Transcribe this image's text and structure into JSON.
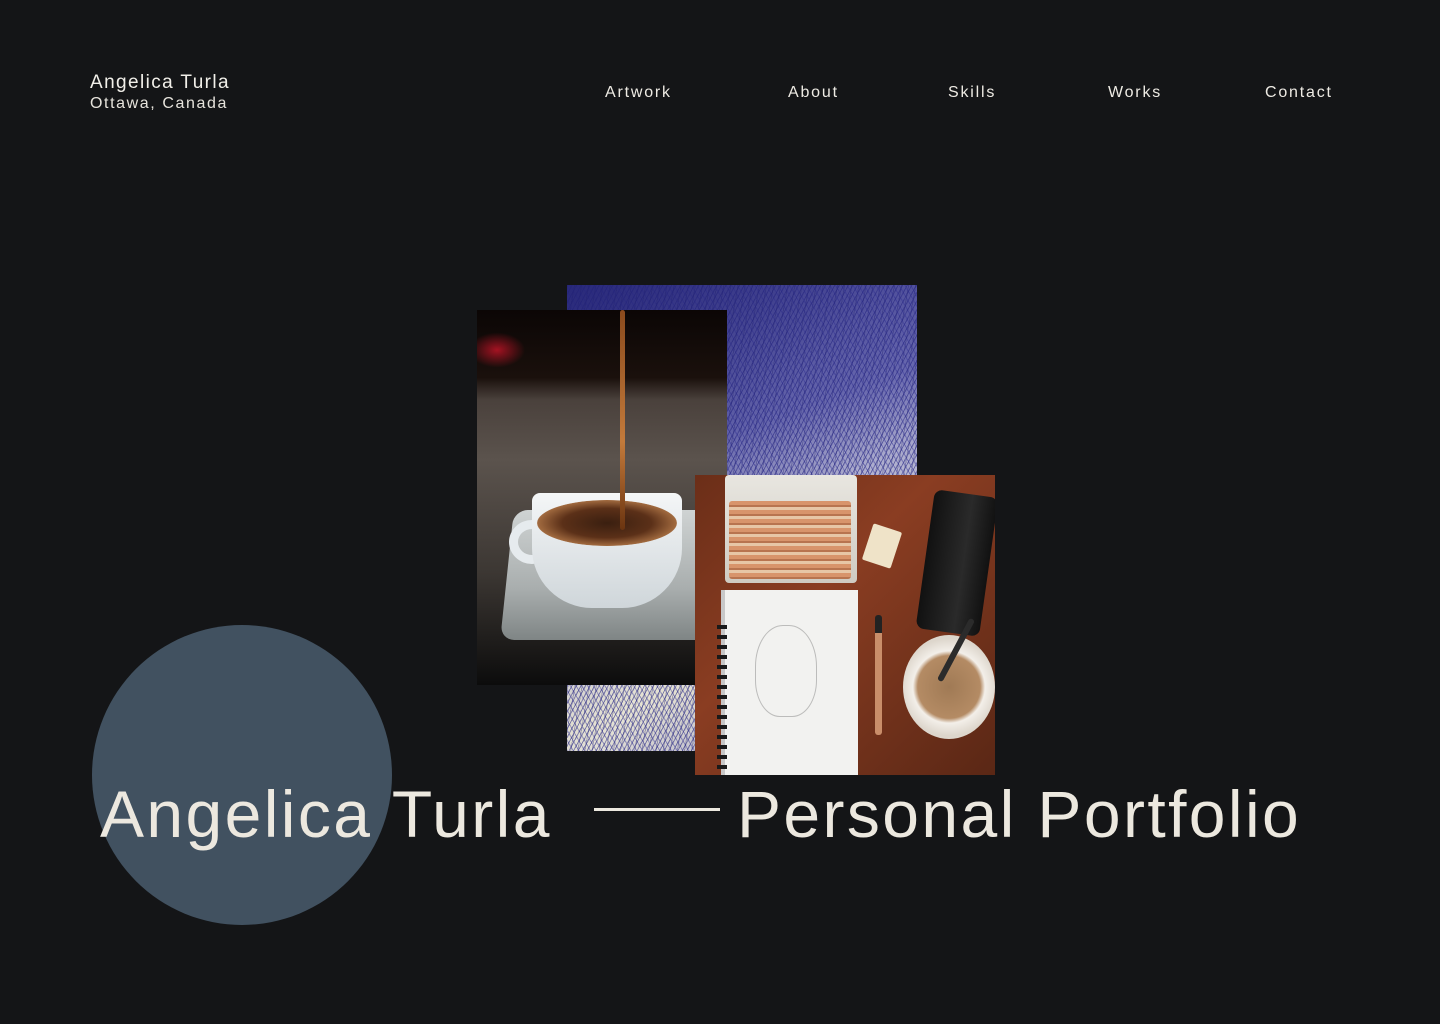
{
  "brand": {
    "name": "Angelica Turla",
    "location": "Ottawa, Canada"
  },
  "nav": {
    "items": [
      {
        "label": "Artwork"
      },
      {
        "label": "About"
      },
      {
        "label": "Skills"
      },
      {
        "label": "Works"
      },
      {
        "label": "Contact"
      }
    ]
  },
  "hero": {
    "name": "Angelica Turla",
    "tagline": "Personal Portfolio"
  },
  "colors": {
    "background": "#141517",
    "text": "#ece8df",
    "accent_circle": "#415160"
  }
}
